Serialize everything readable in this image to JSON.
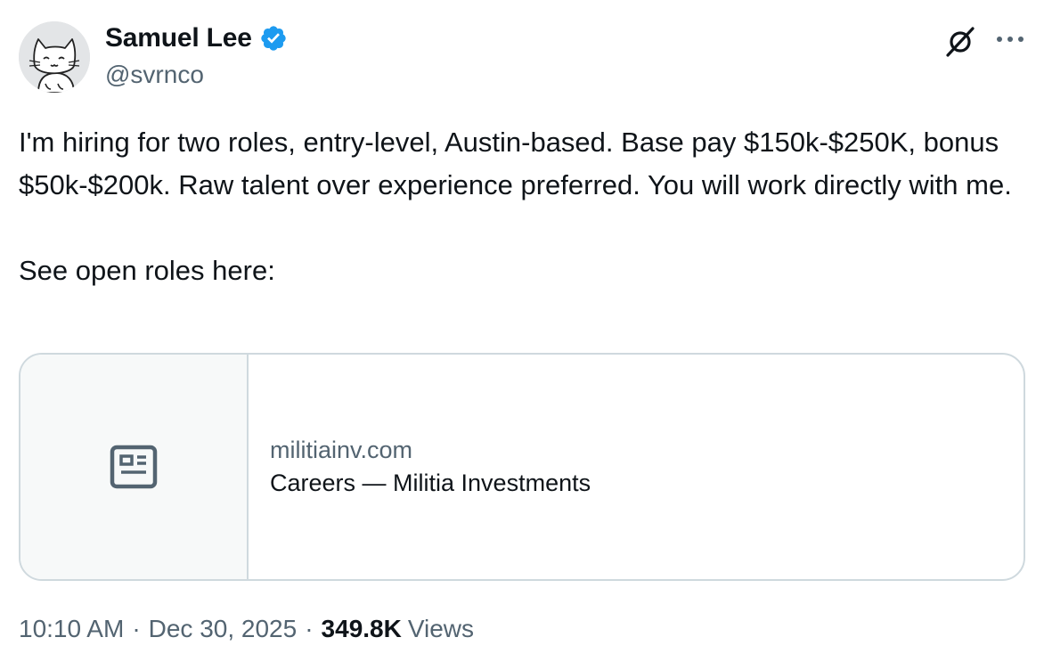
{
  "author": {
    "display_name": "Samuel Lee",
    "handle": "@svrnco",
    "verified": true,
    "verified_color": "#1d9bf0"
  },
  "tweet": {
    "paragraphs": [
      "I'm hiring for two roles, entry-level, Austin-based. Base pay $150k-$250K, bonus $50k-$200k. Raw talent over experience preferred. You will work directly with me.",
      "See open roles here:"
    ]
  },
  "link_card": {
    "domain": "militiainv.com",
    "title": "Careers — Militia Investments",
    "thumbnail_icon": "article-icon"
  },
  "meta": {
    "time": "10:10 AM",
    "date": "Dec 30, 2025",
    "separator": "·",
    "views_count": "349.8K",
    "views_label": "Views"
  },
  "icons": {
    "grok": "grok-icon",
    "more": "more-icon"
  },
  "colors": {
    "text_primary": "#0f1419",
    "text_secondary": "#536471",
    "border": "#cfd9de"
  }
}
